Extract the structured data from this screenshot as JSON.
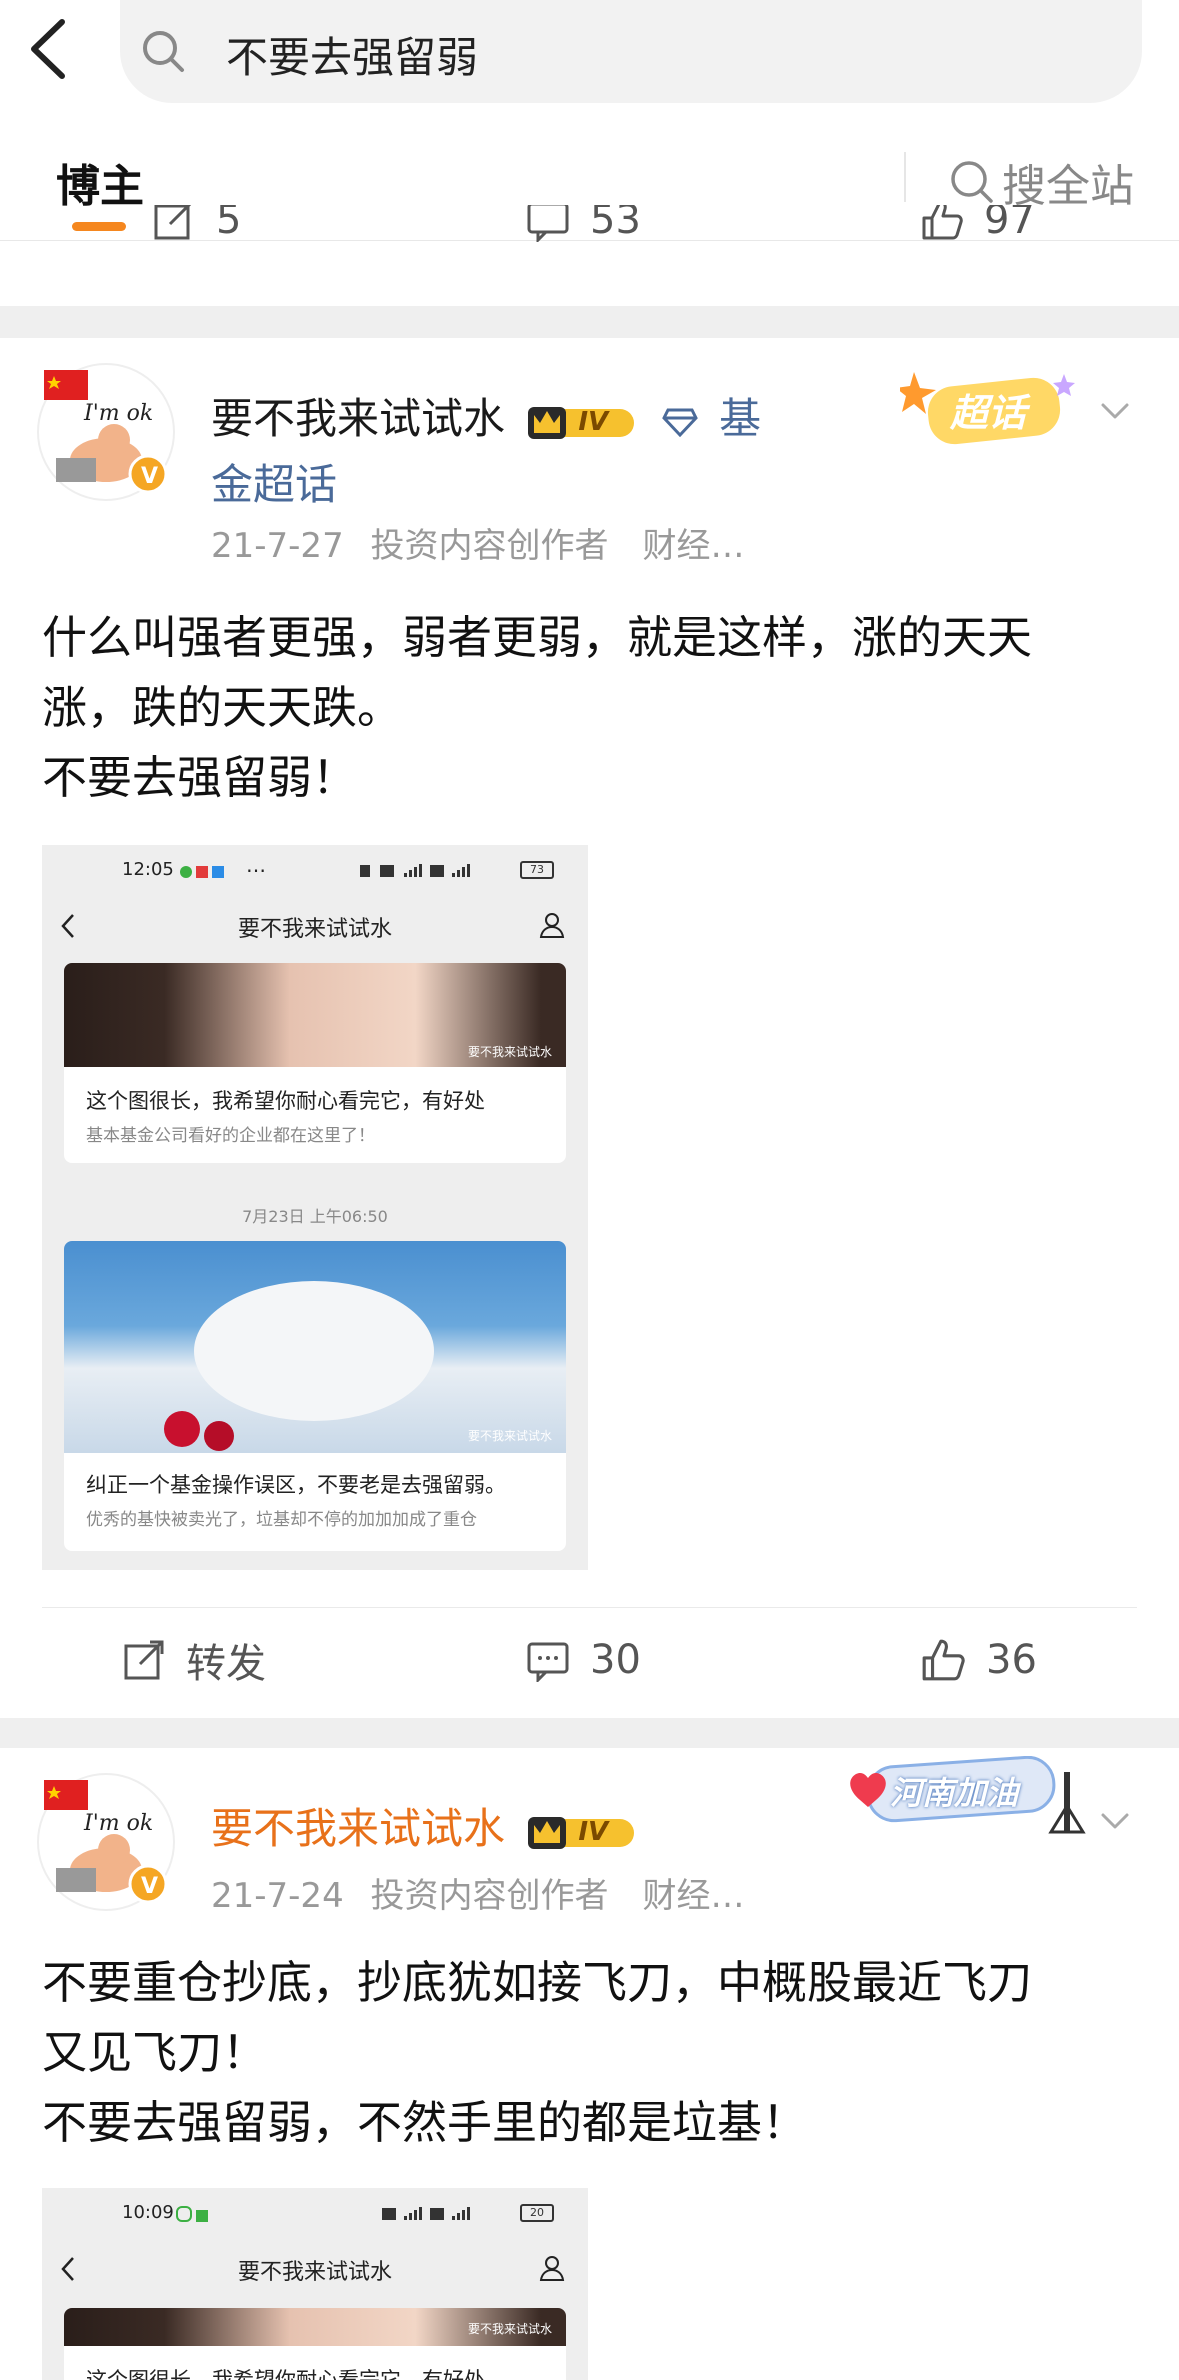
{
  "header": {
    "search_query": "不要去强留弱",
    "tabs": [
      "博主"
    ],
    "search_all_label": "搜全站"
  },
  "top_actions": {
    "repost": "5",
    "comments": "53",
    "likes": "97"
  },
  "colors": {
    "accent": "#f5871f",
    "link": "#4a6a99",
    "orange_name": "#e8711a",
    "separator": "#efefef"
  },
  "posts": [
    {
      "author": "要不我来试试水",
      "level_badge": "IV",
      "supertopic_prefix": "基",
      "supertopic_suffix": "金超话",
      "sticker_label": "超话",
      "time": "21-7-27",
      "source": "投资内容创作者　财经…",
      "text_lines": [
        "什么叫强者更强，弱者更弱，就是这样，涨的天天",
        "涨，跌的天天跌。",
        "不要去强留弱！"
      ],
      "screenshot": {
        "status_time": "12:05",
        "title": "要不我来试试水",
        "card1_title": "这个图很长，我希望你耐心看完它，有好处",
        "card1_sub": "基本基金公司看好的企业都在这里了！",
        "watermark": "要不我来试试水",
        "date_label": "7月23日 上午06:50",
        "card2_title": "纠正一个基金操作误区，不要老是去强留弱。",
        "card2_sub": "优秀的基快被卖光了，垃基却不停的加加加成了重仓",
        "battery": "73"
      },
      "repost_label": "转发",
      "comments": "30",
      "likes": "36"
    },
    {
      "author": "要不我来试试水",
      "level_badge": "IV",
      "sticker_label": "河南加油",
      "time": "21-7-24",
      "source": "投资内容创作者　财经…",
      "text_lines": [
        "不要重仓抄底，抄底犹如接飞刀，中概股最近飞刀",
        "又见飞刀！",
        "不要去强留弱，不然手里的都是垃基！"
      ],
      "screenshot": {
        "status_time": "10:09",
        "title": "要不我来试试水",
        "card1_title": "这个图很长，我希望你耐心看完它，有好处",
        "watermark": "要不我来试试水",
        "battery": "20"
      }
    }
  ]
}
